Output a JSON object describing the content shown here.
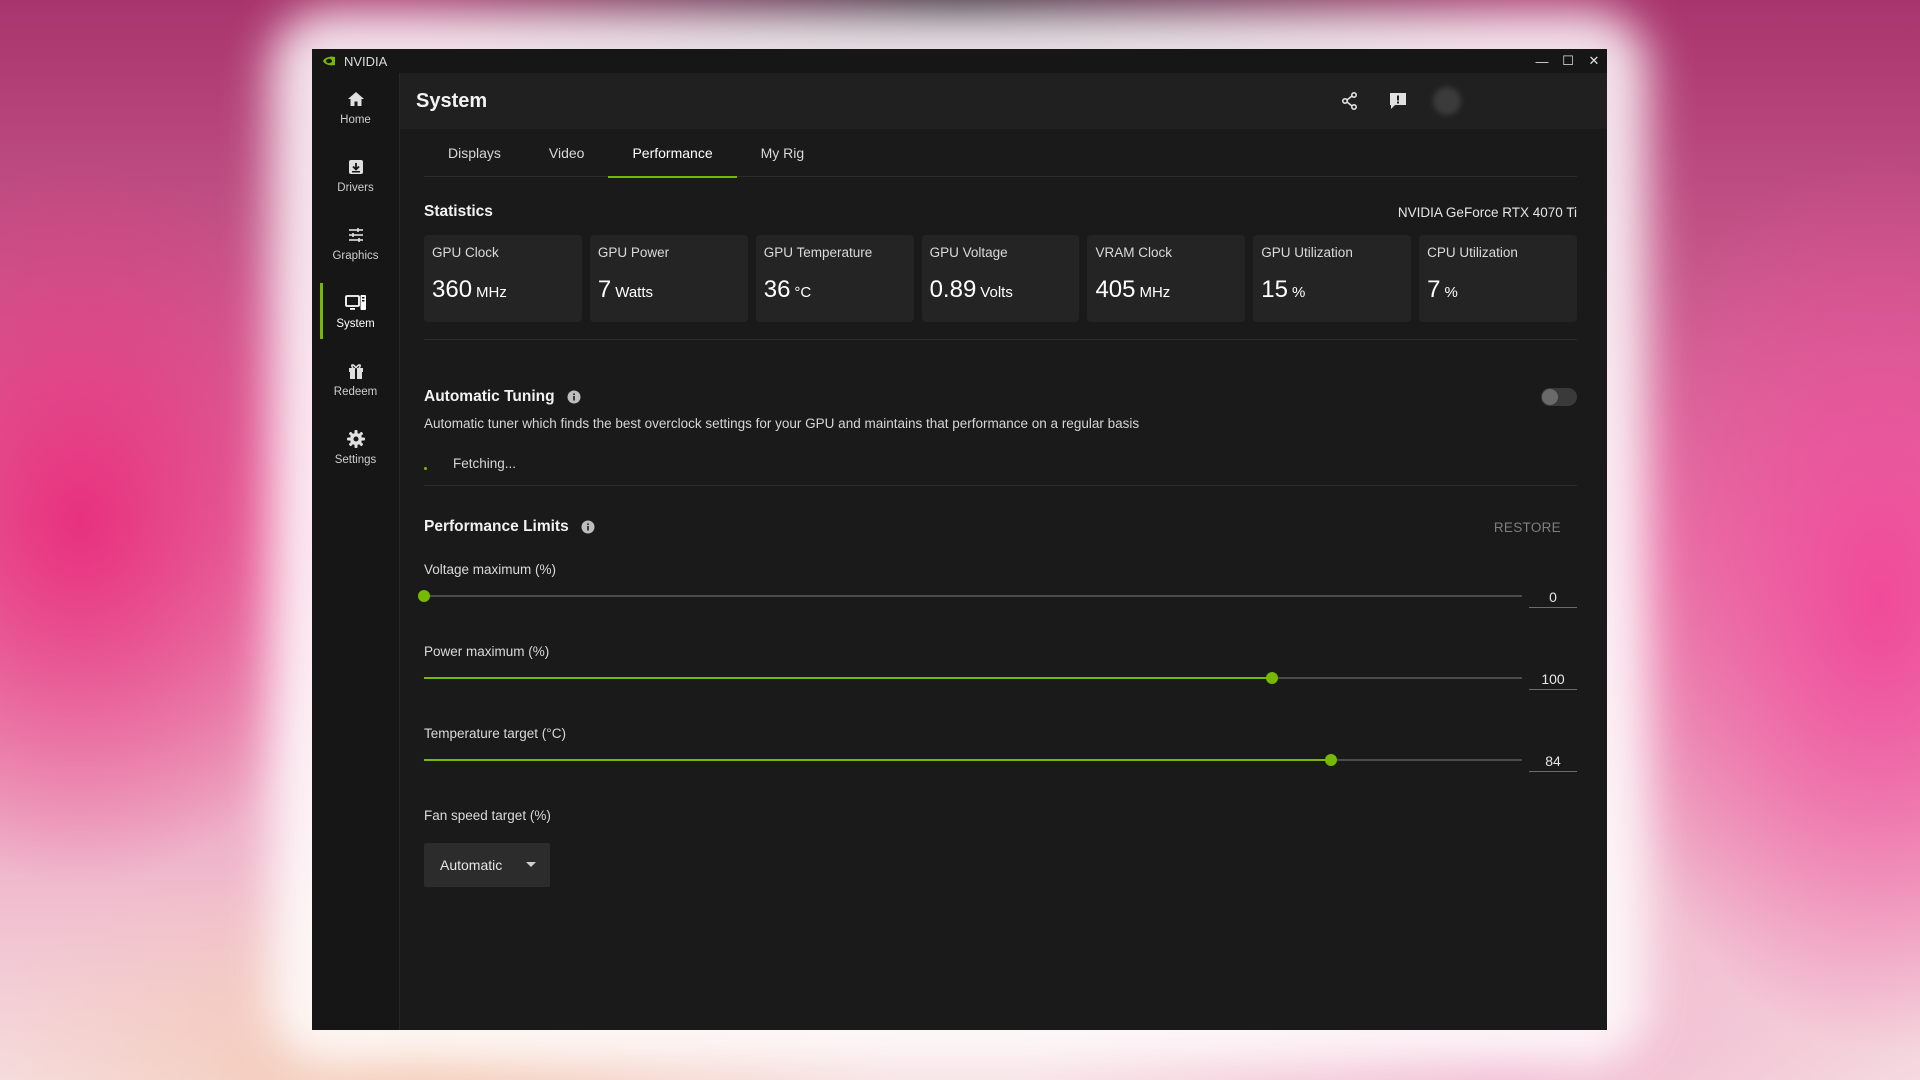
{
  "app": {
    "title": "NVIDIA"
  },
  "window_controls": {
    "minimize": "—",
    "maximize": "☐",
    "close": "✕"
  },
  "sidebar": {
    "items": [
      {
        "label": "Home",
        "icon": "home-icon",
        "active": false
      },
      {
        "label": "Drivers",
        "icon": "drivers-icon",
        "active": false
      },
      {
        "label": "Graphics",
        "icon": "graphics-sliders-icon",
        "active": false
      },
      {
        "label": "System",
        "icon": "system-icon",
        "active": true
      },
      {
        "label": "Redeem",
        "icon": "gift-icon",
        "active": false
      },
      {
        "label": "Settings",
        "icon": "gear-icon",
        "active": false
      }
    ]
  },
  "header": {
    "title": "System",
    "share_icon": "share-icon",
    "feedback_icon": "feedback-icon"
  },
  "tabs": [
    {
      "label": "Displays",
      "active": false
    },
    {
      "label": "Video",
      "active": false
    },
    {
      "label": "Performance",
      "active": true
    },
    {
      "label": "My Rig",
      "active": false
    }
  ],
  "statistics": {
    "title": "Statistics",
    "gpu_name": "NVIDIA GeForce RTX 4070 Ti",
    "cards": [
      {
        "label": "GPU Clock",
        "value": "360",
        "unit": "MHz"
      },
      {
        "label": "GPU Power",
        "value": "7",
        "unit": "Watts"
      },
      {
        "label": "GPU Temperature",
        "value": "36",
        "unit": "°C"
      },
      {
        "label": "GPU Voltage",
        "value": "0.89",
        "unit": "Volts"
      },
      {
        "label": "VRAM Clock",
        "value": "405",
        "unit": "MHz"
      },
      {
        "label": "GPU Utilization",
        "value": "15",
        "unit": "%"
      },
      {
        "label": "CPU Utilization",
        "value": "7",
        "unit": "%"
      }
    ]
  },
  "automatic_tuning": {
    "title": "Automatic Tuning",
    "description": "Automatic tuner which finds the best overclock settings for your GPU and maintains that performance on a regular basis",
    "status": "Fetching...",
    "enabled": false
  },
  "performance_limits": {
    "title": "Performance Limits",
    "restore_label": "RESTORE",
    "sliders": [
      {
        "label": "Voltage maximum (%)",
        "value": "0",
        "fraction": 0.0
      },
      {
        "label": "Power maximum (%)",
        "value": "100",
        "fraction": 0.772
      },
      {
        "label": "Temperature target (°C)",
        "value": "84",
        "fraction": 0.826
      }
    ],
    "fan": {
      "label": "Fan speed target (%)",
      "selected": "Automatic"
    }
  },
  "colors": {
    "accent": "#76b900",
    "background": "#1a1a1a",
    "card": "#242424"
  }
}
